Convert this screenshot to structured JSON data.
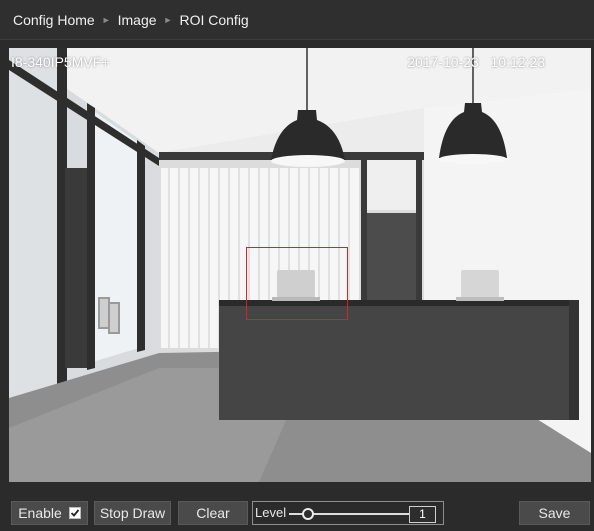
{
  "breadcrumb": {
    "items": [
      "Config Home",
      "Image",
      "ROI Config"
    ],
    "separator": "►"
  },
  "video": {
    "camera_name": "I8-340IP5MVF+",
    "date": "2017-10-23",
    "time": "10:12:23"
  },
  "toolbar": {
    "enable_label": "Enable",
    "enable_checked": true,
    "stop_draw_label": "Stop Draw",
    "clear_label": "Clear",
    "level_label": "Level",
    "level_value": "1",
    "save_label": "Save"
  },
  "colors": {
    "background": "#2b2b2b",
    "button": "#4a4a4a",
    "roi_box": "#d42424"
  }
}
